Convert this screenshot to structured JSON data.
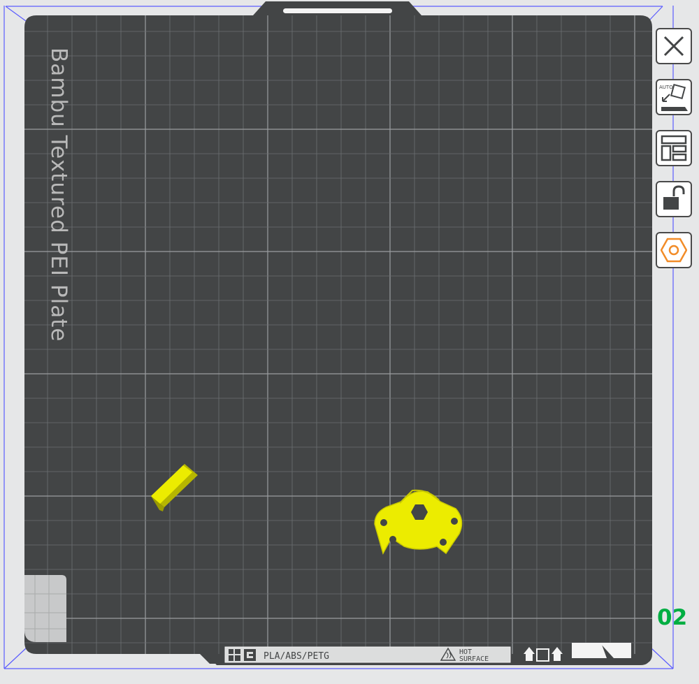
{
  "plate": {
    "name": "Bambu Textured PEI Plate",
    "number": "02",
    "material_label": "PLA/ABS/PETG",
    "warning": {
      "line1": "HOT",
      "line2": "SURFACE"
    }
  },
  "toolbar": {
    "buttons": [
      {
        "id": "close",
        "icon": "close-icon"
      },
      {
        "id": "auto-orient",
        "icon": "auto-orient-icon",
        "badge": "AUTO"
      },
      {
        "id": "arrange",
        "icon": "arrange-layout-icon"
      },
      {
        "id": "lock",
        "icon": "unlock-icon"
      },
      {
        "id": "plate-settings",
        "icon": "hexagon-settings-icon"
      }
    ]
  },
  "colors": {
    "background": "#e6e7e8",
    "plate": "#434546",
    "grid": "#8a8d90",
    "bounding_box": "#5b5cff",
    "model": "#ecec00",
    "accent_orange": "#f28c28",
    "plate_number": "#00ae42"
  },
  "objects": [
    {
      "name": "bar",
      "shape": "rectangular-bar"
    },
    {
      "name": "hex-mount",
      "shape": "three-lobed-part-with-hex-hole"
    }
  ]
}
